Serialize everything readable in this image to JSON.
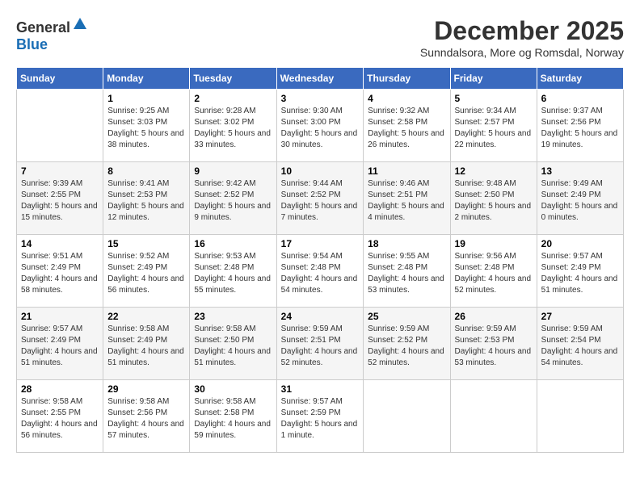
{
  "header": {
    "logo_general": "General",
    "logo_blue": "Blue",
    "month_title": "December 2025",
    "location": "Sunndalsora, More og Romsdal, Norway"
  },
  "weekdays": [
    "Sunday",
    "Monday",
    "Tuesday",
    "Wednesday",
    "Thursday",
    "Friday",
    "Saturday"
  ],
  "weeks": [
    [
      {
        "day": "",
        "info": ""
      },
      {
        "day": "1",
        "info": "Sunrise: 9:25 AM\nSunset: 3:03 PM\nDaylight: 5 hours\nand 38 minutes."
      },
      {
        "day": "2",
        "info": "Sunrise: 9:28 AM\nSunset: 3:02 PM\nDaylight: 5 hours\nand 33 minutes."
      },
      {
        "day": "3",
        "info": "Sunrise: 9:30 AM\nSunset: 3:00 PM\nDaylight: 5 hours\nand 30 minutes."
      },
      {
        "day": "4",
        "info": "Sunrise: 9:32 AM\nSunset: 2:58 PM\nDaylight: 5 hours\nand 26 minutes."
      },
      {
        "day": "5",
        "info": "Sunrise: 9:34 AM\nSunset: 2:57 PM\nDaylight: 5 hours\nand 22 minutes."
      },
      {
        "day": "6",
        "info": "Sunrise: 9:37 AM\nSunset: 2:56 PM\nDaylight: 5 hours\nand 19 minutes."
      }
    ],
    [
      {
        "day": "7",
        "info": "Sunrise: 9:39 AM\nSunset: 2:55 PM\nDaylight: 5 hours\nand 15 minutes."
      },
      {
        "day": "8",
        "info": "Sunrise: 9:41 AM\nSunset: 2:53 PM\nDaylight: 5 hours\nand 12 minutes."
      },
      {
        "day": "9",
        "info": "Sunrise: 9:42 AM\nSunset: 2:52 PM\nDaylight: 5 hours\nand 9 minutes."
      },
      {
        "day": "10",
        "info": "Sunrise: 9:44 AM\nSunset: 2:52 PM\nDaylight: 5 hours\nand 7 minutes."
      },
      {
        "day": "11",
        "info": "Sunrise: 9:46 AM\nSunset: 2:51 PM\nDaylight: 5 hours\nand 4 minutes."
      },
      {
        "day": "12",
        "info": "Sunrise: 9:48 AM\nSunset: 2:50 PM\nDaylight: 5 hours\nand 2 minutes."
      },
      {
        "day": "13",
        "info": "Sunrise: 9:49 AM\nSunset: 2:49 PM\nDaylight: 5 hours\nand 0 minutes."
      }
    ],
    [
      {
        "day": "14",
        "info": "Sunrise: 9:51 AM\nSunset: 2:49 PM\nDaylight: 4 hours\nand 58 minutes."
      },
      {
        "day": "15",
        "info": "Sunrise: 9:52 AM\nSunset: 2:49 PM\nDaylight: 4 hours\nand 56 minutes."
      },
      {
        "day": "16",
        "info": "Sunrise: 9:53 AM\nSunset: 2:48 PM\nDaylight: 4 hours\nand 55 minutes."
      },
      {
        "day": "17",
        "info": "Sunrise: 9:54 AM\nSunset: 2:48 PM\nDaylight: 4 hours\nand 54 minutes."
      },
      {
        "day": "18",
        "info": "Sunrise: 9:55 AM\nSunset: 2:48 PM\nDaylight: 4 hours\nand 53 minutes."
      },
      {
        "day": "19",
        "info": "Sunrise: 9:56 AM\nSunset: 2:48 PM\nDaylight: 4 hours\nand 52 minutes."
      },
      {
        "day": "20",
        "info": "Sunrise: 9:57 AM\nSunset: 2:49 PM\nDaylight: 4 hours\nand 51 minutes."
      }
    ],
    [
      {
        "day": "21",
        "info": "Sunrise: 9:57 AM\nSunset: 2:49 PM\nDaylight: 4 hours\nand 51 minutes."
      },
      {
        "day": "22",
        "info": "Sunrise: 9:58 AM\nSunset: 2:49 PM\nDaylight: 4 hours\nand 51 minutes."
      },
      {
        "day": "23",
        "info": "Sunrise: 9:58 AM\nSunset: 2:50 PM\nDaylight: 4 hours\nand 51 minutes."
      },
      {
        "day": "24",
        "info": "Sunrise: 9:59 AM\nSunset: 2:51 PM\nDaylight: 4 hours\nand 52 minutes."
      },
      {
        "day": "25",
        "info": "Sunrise: 9:59 AM\nSunset: 2:52 PM\nDaylight: 4 hours\nand 52 minutes."
      },
      {
        "day": "26",
        "info": "Sunrise: 9:59 AM\nSunset: 2:53 PM\nDaylight: 4 hours\nand 53 minutes."
      },
      {
        "day": "27",
        "info": "Sunrise: 9:59 AM\nSunset: 2:54 PM\nDaylight: 4 hours\nand 54 minutes."
      }
    ],
    [
      {
        "day": "28",
        "info": "Sunrise: 9:58 AM\nSunset: 2:55 PM\nDaylight: 4 hours\nand 56 minutes."
      },
      {
        "day": "29",
        "info": "Sunrise: 9:58 AM\nSunset: 2:56 PM\nDaylight: 4 hours\nand 57 minutes."
      },
      {
        "day": "30",
        "info": "Sunrise: 9:58 AM\nSunset: 2:58 PM\nDaylight: 4 hours\nand 59 minutes."
      },
      {
        "day": "31",
        "info": "Sunrise: 9:57 AM\nSunset: 2:59 PM\nDaylight: 5 hours\nand 1 minute."
      },
      {
        "day": "",
        "info": ""
      },
      {
        "day": "",
        "info": ""
      },
      {
        "day": "",
        "info": ""
      }
    ]
  ]
}
